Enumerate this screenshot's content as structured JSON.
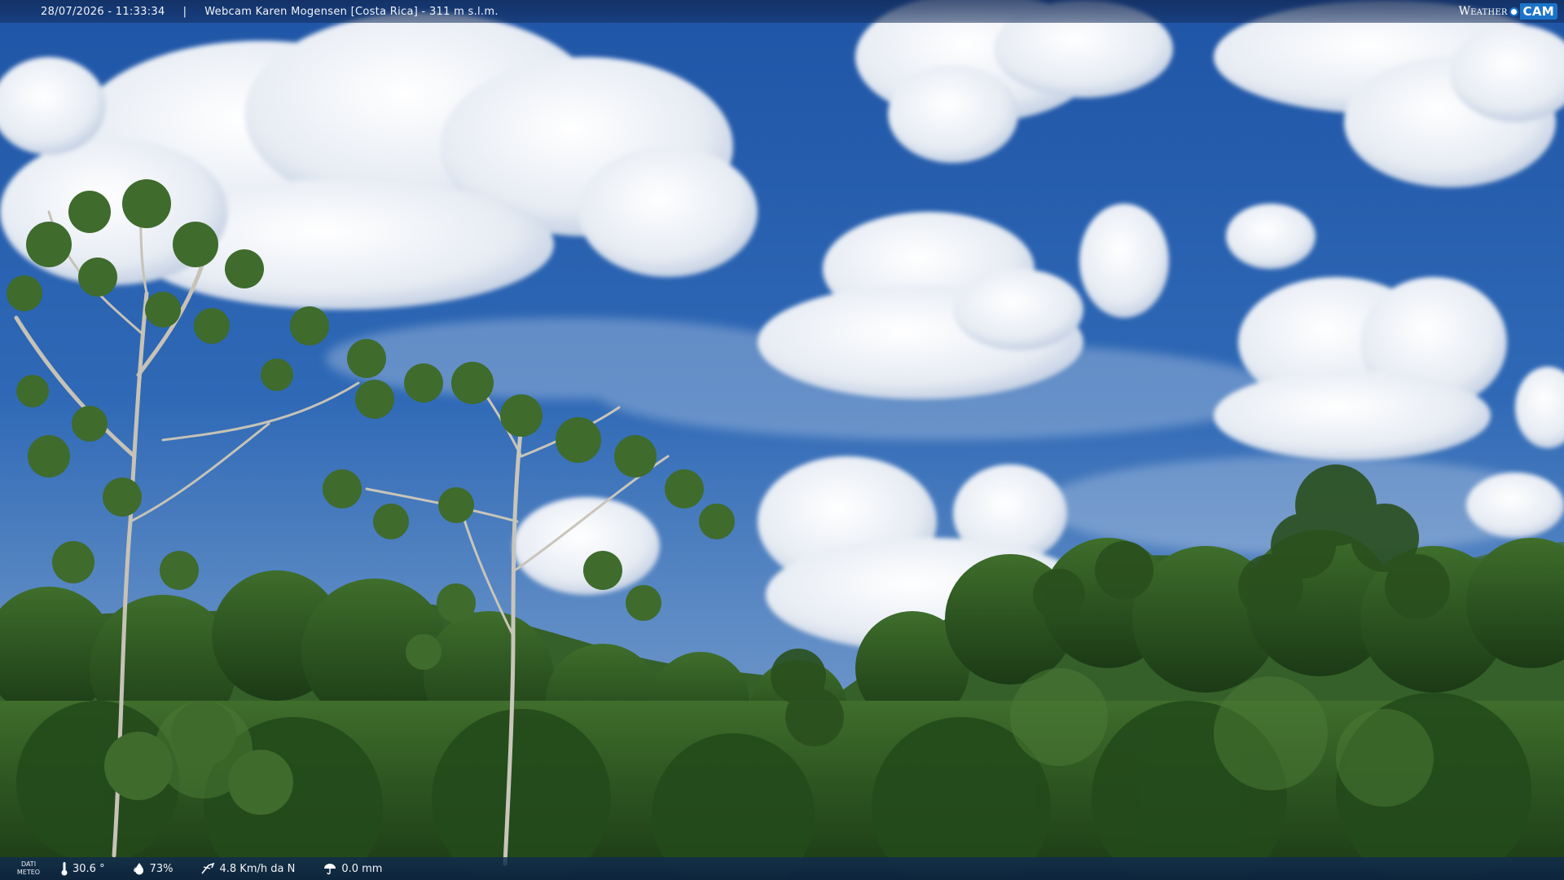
{
  "overlay": {
    "datetime": "28/07/2026 - 11:33:34",
    "separator": "|",
    "location": "Webcam Karen Mogensen [Costa Rica] - 311 m s.l.m."
  },
  "brand": {
    "weather": "Weather",
    "cam": "CAM",
    "color": "#1b74c9"
  },
  "meteo": {
    "label_line1": "DATI",
    "label_line2": "METEO",
    "temperature": "30.6 °",
    "humidity": "73%",
    "wind": "4.8 Km/h da N",
    "rain": "0.0 mm",
    "temperature_icon": "thermometer-icon",
    "humidity_icon": "droplet-icon",
    "wind_icon": "wind-icon",
    "rain_icon": "umbrella-icon"
  },
  "scene": {
    "sky_color": "#2b63b0",
    "cloud_color": "#eef1f6",
    "forest_color": "#2f5a22"
  }
}
